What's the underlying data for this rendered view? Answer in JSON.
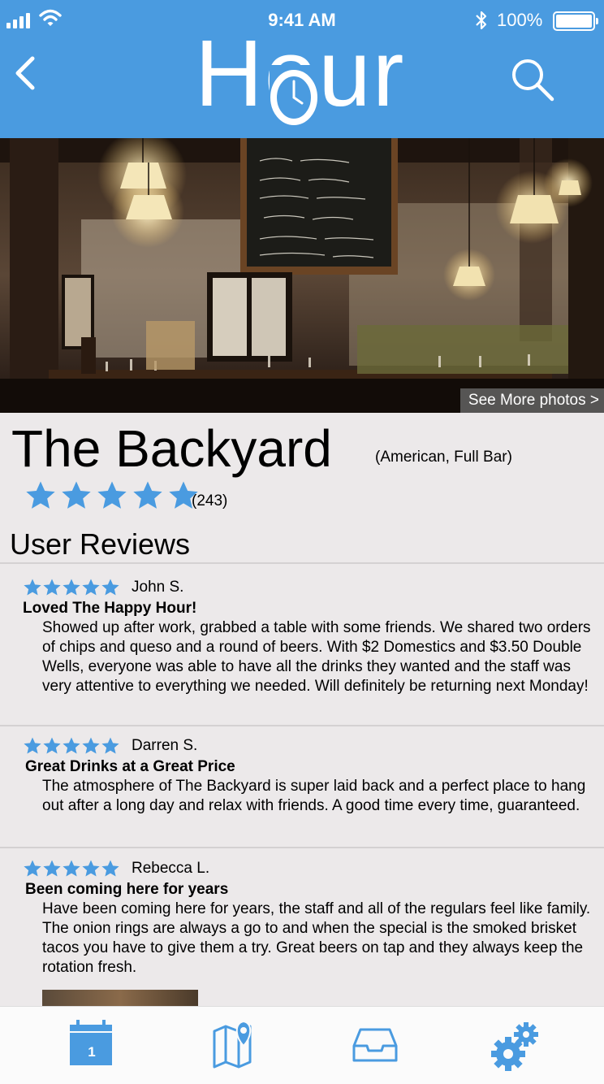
{
  "status_bar": {
    "time": "9:41 AM",
    "battery": "100%",
    "battery_level": 1.0
  },
  "header": {
    "logo_text": "Hour",
    "back_icon": "chevron-left-icon",
    "search_icon": "search-icon"
  },
  "colors": {
    "brand_blue": "#4a9be0",
    "star_blue": "#4a9be0",
    "background": "#ece9ea"
  },
  "hero": {
    "more_photos_label": "See More photos >"
  },
  "venue": {
    "name": "The Backyard",
    "type": "(American, Full Bar)",
    "rating": 5,
    "review_count": "(243)"
  },
  "reviews_section": {
    "title": "User Reviews"
  },
  "reviews": [
    {
      "author": "John S.",
      "rating": 5,
      "title": "Loved The Happy Hour!",
      "body": "Showed up after work, grabbed a table with some friends. We shared two orders of chips and queso and a round of beers. With $2 Domestics and $3.50 Double Wells, everyone was able to have all the drinks they wanted and the staff was very attentive to everything we needed. Will definitely be returning next Monday!"
    },
    {
      "author": "Darren S.",
      "rating": 5,
      "title": "Great Drinks at a Great Price",
      "body": "The atmosphere of The Backyard is super laid back and a perfect place to hang out after a long day and relax with friends. A good time every time, guaranteed."
    },
    {
      "author": "Rebecca L.",
      "rating": 5,
      "title": "Been coming here for years",
      "body": "Have been coming here for years, the staff and all of the regulars feel like family. The onion rings are always a go to and when the special is the smoked brisket tacos you have to give them a try. Great beers on tap and they always keep the rotation fresh."
    }
  ],
  "tab_bar": {
    "calendar_day": "1",
    "tabs": [
      "calendar-icon",
      "map-pin-icon",
      "inbox-tray-icon",
      "settings-gears-icon"
    ]
  }
}
